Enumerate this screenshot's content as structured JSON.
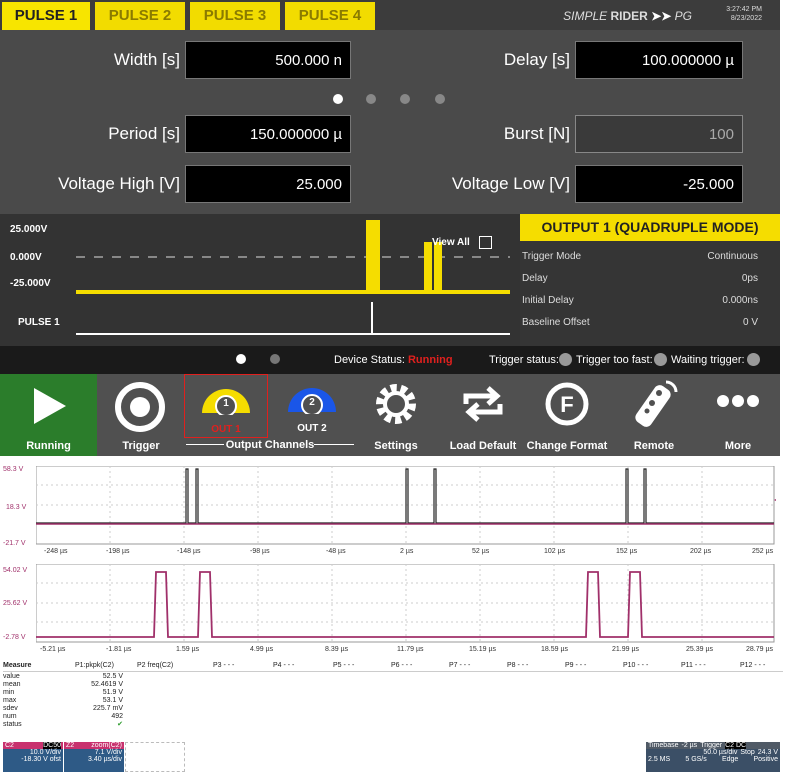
{
  "tabs": [
    "PULSE 1",
    "PULSE 2",
    "PULSE 3",
    "PULSE 4"
  ],
  "brand": {
    "prefix": "SIMPLE",
    "name": "RIDER",
    "suffix": "PG",
    "time": "3:27:42 PM",
    "date": "8/23/2022"
  },
  "params": {
    "width": {
      "label": "Width [s]",
      "value": "500.000 n"
    },
    "delay": {
      "label": "Delay [s]",
      "value": "100.000000 µ"
    },
    "period": {
      "label": "Period [s]",
      "value": "150.000000 µ"
    },
    "burst": {
      "label": "Burst [N]",
      "value": "100"
    },
    "vhigh": {
      "label": "Voltage High [V]",
      "value": "25.000"
    },
    "vlow": {
      "label": "Voltage Low [V]",
      "value": "-25.000"
    }
  },
  "wave": {
    "v_high": "25.000V",
    "v_zero": "0.000V",
    "v_low": "-25.000V",
    "pulse_label": "PULSE 1",
    "view_all": "View All"
  },
  "output": {
    "header": "OUTPUT 1 (QUADRUPLE MODE)",
    "rows": [
      {
        "k": "Trigger Mode",
        "v": "Continuous"
      },
      {
        "k": "Delay",
        "v": "0ps"
      },
      {
        "k": "Initial Delay",
        "v": "0.000ns"
      },
      {
        "k": "Baseline Offset",
        "v": "0 V"
      }
    ]
  },
  "status": {
    "device_label": "Device Status:",
    "device_value": "Running",
    "trigger": "Trigger status:",
    "too_fast": "Trigger too fast:",
    "waiting": "Waiting trigger:"
  },
  "toolbar": {
    "running": "Running",
    "trigger": "Trigger",
    "out1": "OUT 1",
    "out2": "OUT 2",
    "channels": "Output Channels",
    "settings": "Settings",
    "load_default": "Load Default",
    "change_format": "Change Format",
    "remote": "Remote",
    "more": "More",
    "ch1": "1",
    "ch2": "2"
  },
  "colors": {
    "accent": "#f5dd00",
    "running": "#e0201e",
    "trace": "#a0306a"
  },
  "scope": {
    "top": {
      "y_labels": [
        "58.3 V",
        "18.3 V",
        "-21.7 V"
      ],
      "x_labels": [
        "-248 µs",
        "-198 µs",
        "-148 µs",
        "-98 µs",
        "-48 µs",
        "2 µs",
        "52 µs",
        "102 µs",
        "152 µs",
        "202 µs",
        "252 µs"
      ]
    },
    "bottom": {
      "y_labels": [
        "54.02 V",
        "25.62 V",
        "-2.78 V"
      ],
      "x_labels": [
        "-5.21 µs",
        "-1.81 µs",
        "1.59 µs",
        "4.99 µs",
        "8.39 µs",
        "11.79 µs",
        "15.19 µs",
        "18.59 µs",
        "21.99 µs",
        "25.39 µs",
        "28.79 µs"
      ]
    },
    "measure": {
      "headers": [
        "Measure",
        "P1:pkpk(C2)",
        "P2 freq(C2)",
        "P3 - - -",
        "P4 - - -",
        "P5 - - -",
        "P6 - - -",
        "P7 - - -",
        "P8 - - -",
        "P9 - - -",
        "P10 - - -",
        "P11 - - -",
        "P12 - - -"
      ],
      "rows": [
        [
          "value",
          "52.5 V"
        ],
        [
          "mean",
          "52.4619 V"
        ],
        [
          "min",
          "51.9 V"
        ],
        [
          "max",
          "53.1 V"
        ],
        [
          "sdev",
          "225.7 mV"
        ],
        [
          "num",
          "492"
        ],
        [
          "status",
          "✔"
        ]
      ]
    },
    "ch_box1": {
      "title": "C2",
      "tag": "DC50",
      "line1": "10.0 V/div",
      "line2": "-18.30 V ofst"
    },
    "ch_box2": {
      "title": "Z2",
      "tag": "zoom(C2)",
      "line1": "7.1 V/div",
      "line2": "3.40 µs/div"
    },
    "timebase": {
      "label": "Timebase",
      "tb_val": "-2 µs",
      "trig_label": "Trigger",
      "tags": "C2 DC",
      "r1a": "50.0 µs/div",
      "r1b": "Stop",
      "r1c": "24.3 V",
      "r2a": "2.5 MS",
      "r2b": "5 GS/s",
      "r2c": "Edge",
      "r2d": "Positive"
    }
  }
}
